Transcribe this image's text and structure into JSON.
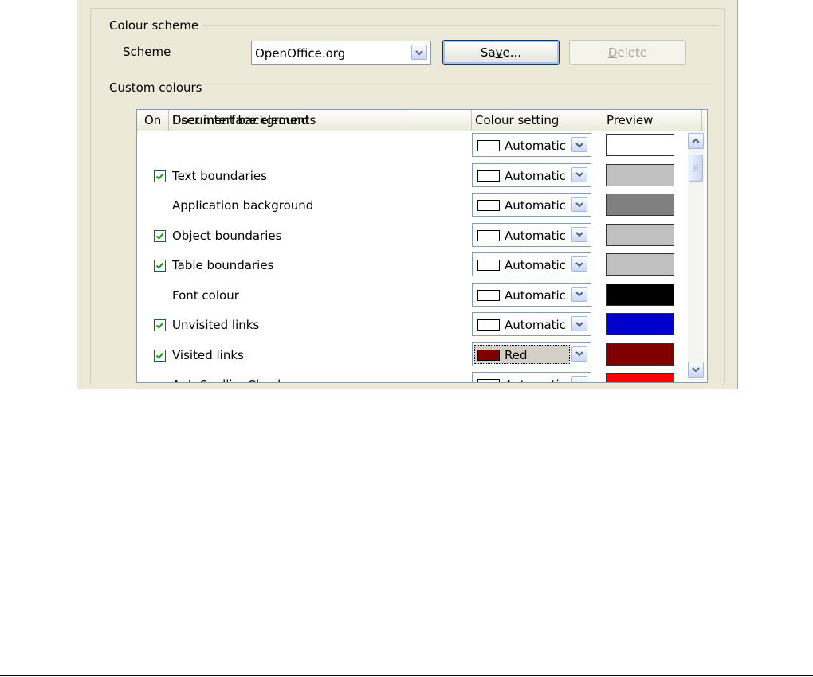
{
  "colour_scheme": {
    "section_label": "Colour scheme",
    "scheme_label_mnemonic": "S",
    "scheme_label_rest": "cheme",
    "scheme_value": "OpenOffice.org",
    "save_button": {
      "pre": "Sa",
      "mnemonic": "v",
      "post": "e..."
    },
    "delete_button": {
      "mnemonic": "D",
      "post": "elete"
    }
  },
  "custom_colours": {
    "section_label": "Custom colours",
    "headers": {
      "on": "On",
      "element": "User interface elements",
      "colour": "Colour setting",
      "preview": "Preview"
    },
    "rows": [
      {
        "label": "Document background",
        "checkbox": false,
        "checked": false,
        "colour_label": "Automatic",
        "swatch": "#ffffff",
        "preview": "#ffffff"
      },
      {
        "label": "Text boundaries",
        "checkbox": true,
        "checked": true,
        "colour_label": "Automatic",
        "swatch": "#ffffff",
        "preview": "#c0c0c0"
      },
      {
        "label": "Application background",
        "checkbox": false,
        "checked": false,
        "colour_label": "Automatic",
        "swatch": "#ffffff",
        "preview": "#808080"
      },
      {
        "label": "Object boundaries",
        "checkbox": true,
        "checked": true,
        "colour_label": "Automatic",
        "swatch": "#ffffff",
        "preview": "#c0c0c0"
      },
      {
        "label": "Table boundaries",
        "checkbox": true,
        "checked": true,
        "colour_label": "Automatic",
        "swatch": "#ffffff",
        "preview": "#c0c0c0"
      },
      {
        "label": "Font colour",
        "checkbox": false,
        "checked": false,
        "colour_label": "Automatic",
        "swatch": "#ffffff",
        "preview": "#000000"
      },
      {
        "label": "Unvisited links",
        "checkbox": true,
        "checked": true,
        "colour_label": "Automatic",
        "swatch": "#ffffff",
        "preview": "#0000cc"
      },
      {
        "label": "Visited links",
        "checkbox": true,
        "checked": true,
        "colour_label": "Red",
        "swatch": "#800000",
        "preview": "#800000"
      },
      {
        "label": "AutoSpellingCheck",
        "checkbox": false,
        "checked": false,
        "colour_label": "Automatic",
        "swatch": "#ffffff",
        "preview": "#ff0000"
      }
    ]
  },
  "colors": {
    "dialog_bg": "#ece9d8",
    "checkmark": "#21a121"
  }
}
